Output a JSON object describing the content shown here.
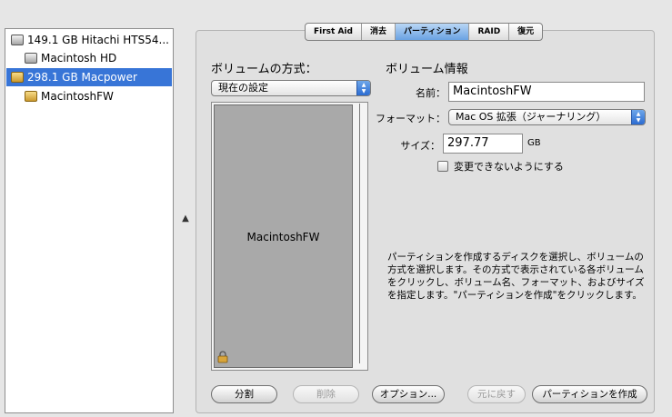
{
  "sidebar": {
    "items": [
      {
        "label": "149.1 GB Hitachi HTS54...",
        "kind": "disk"
      },
      {
        "label": "Macintosh HD",
        "kind": "volume"
      },
      {
        "label": "298.1 GB Macpower",
        "kind": "disk",
        "selected": true
      },
      {
        "label": "MacintoshFW",
        "kind": "volume"
      }
    ]
  },
  "tabs": [
    {
      "label": "First Aid"
    },
    {
      "label": "消去"
    },
    {
      "label": "パーティション",
      "active": true
    },
    {
      "label": "RAID"
    },
    {
      "label": "復元"
    }
  ],
  "partition": {
    "scheme_heading": "ボリュームの方式：",
    "scheme_value": "現在の設定",
    "volume_label": "MacintoshFW"
  },
  "volume_info": {
    "heading": "ボリューム情報",
    "name_label": "名前：",
    "name_value": "MacintoshFW",
    "format_label": "フォーマット：",
    "format_value": "Mac OS 拡張（ジャーナリング）",
    "size_label": "サイズ：",
    "size_value": "297.77",
    "size_unit": "GB",
    "lock_label": "変更できないようにする",
    "help_text": "パーティションを作成するディスクを選択し、ボリュームの方式を選択します。その方式で表示されている各ボリュームをクリックし、ボリューム名、フォーマット、およびサイズを指定します。\"パーティションを作成\"をクリックします。"
  },
  "buttons": {
    "split": "分割",
    "delete": "削除",
    "options": "オプション...",
    "revert": "元に戻す",
    "create": "パーティションを作成"
  },
  "colors": {
    "selection": "#3875d7",
    "tab_active": "#6aa2e3",
    "volume_block": "#a9a9a9"
  }
}
